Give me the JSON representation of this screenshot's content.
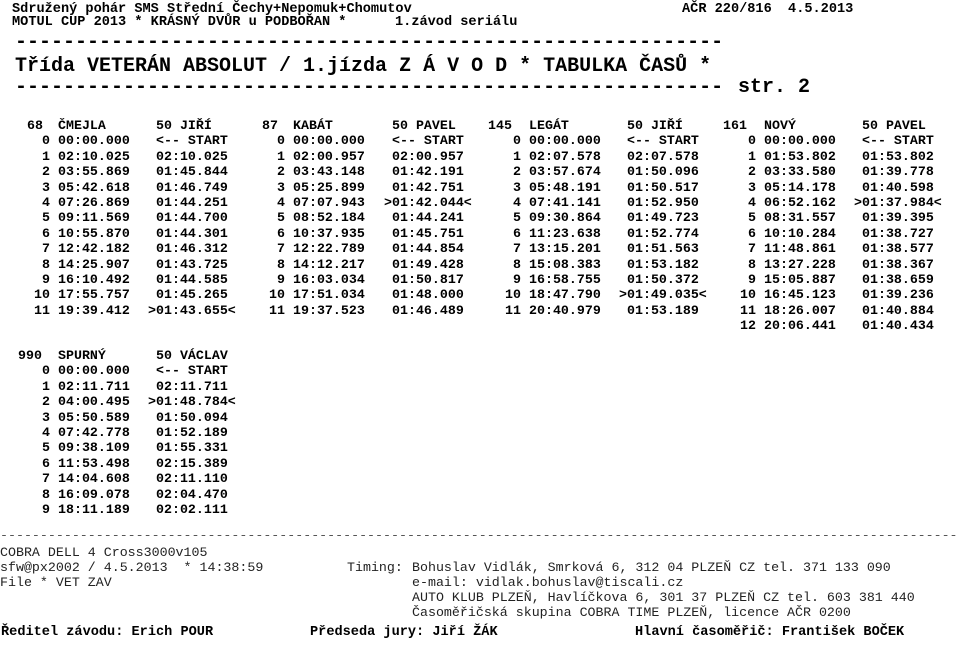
{
  "header": {
    "organizer": "Sdružený pohár SMS Střední Čechy+Nepomuk+Chomutov",
    "permit": "AČR 220/816  4.5.2013",
    "event": "MOTUL CUP 2013 * KRÁSNÝ DVŮR u PODBOŘAN *",
    "round": "1.závod seriálu",
    "title": "Třída VETERÁN ABSOLUT / 1.jízda Z Á V O D * TABULKA ČASŮ *",
    "page": "str. 2"
  },
  "blocks": [
    {
      "number": "68",
      "surname": "ČMEJLA",
      "driver": "50 JIŘÍ",
      "laps": [
        [
          "0",
          "00:00.000",
          "<-- START"
        ],
        [
          "1",
          "02:10.025",
          "02:10.025"
        ],
        [
          "2",
          "03:55.869",
          "01:45.844"
        ],
        [
          "3",
          "05:42.618",
          "01:46.749"
        ],
        [
          "4",
          "07:26.869",
          "01:44.251"
        ],
        [
          "5",
          "09:11.569",
          "01:44.700"
        ],
        [
          "6",
          "10:55.870",
          "01:44.301"
        ],
        [
          "7",
          "12:42.182",
          "01:46.312"
        ],
        [
          "8",
          "14:25.907",
          "01:43.725"
        ],
        [
          "9",
          "16:10.492",
          "01:44.585"
        ],
        [
          "10",
          "17:55.757",
          "01:45.265"
        ],
        [
          "11",
          "19:39.412",
          ">01:43.655<"
        ]
      ]
    },
    {
      "number": "87",
      "surname": "KABÁT",
      "driver": "50 PAVEL",
      "laps": [
        [
          "0",
          "00:00.000",
          "<-- START"
        ],
        [
          "1",
          "02:00.957",
          "02:00.957"
        ],
        [
          "2",
          "03:43.148",
          "01:42.191"
        ],
        [
          "3",
          "05:25.899",
          "01:42.751"
        ],
        [
          "4",
          "07:07.943",
          ">01:42.044<"
        ],
        [
          "5",
          "08:52.184",
          "01:44.241"
        ],
        [
          "6",
          "10:37.935",
          "01:45.751"
        ],
        [
          "7",
          "12:22.789",
          "01:44.854"
        ],
        [
          "8",
          "14:12.217",
          "01:49.428"
        ],
        [
          "9",
          "16:03.034",
          "01:50.817"
        ],
        [
          "10",
          "17:51.034",
          "01:48.000"
        ],
        [
          "11",
          "19:37.523",
          "01:46.489"
        ]
      ]
    },
    {
      "number": "145",
      "surname": "LEGÁT",
      "driver": "50 JIŘÍ",
      "laps": [
        [
          "0",
          "00:00.000",
          "<-- START"
        ],
        [
          "1",
          "02:07.578",
          "02:07.578"
        ],
        [
          "2",
          "03:57.674",
          "01:50.096"
        ],
        [
          "3",
          "05:48.191",
          "01:50.517"
        ],
        [
          "4",
          "07:41.141",
          "01:52.950"
        ],
        [
          "5",
          "09:30.864",
          "01:49.723"
        ],
        [
          "6",
          "11:23.638",
          "01:52.774"
        ],
        [
          "7",
          "13:15.201",
          "01:51.563"
        ],
        [
          "8",
          "15:08.383",
          "01:53.182"
        ],
        [
          "9",
          "16:58.755",
          "01:50.372"
        ],
        [
          "10",
          "18:47.790",
          ">01:49.035<"
        ],
        [
          "11",
          "20:40.979",
          "01:53.189"
        ]
      ]
    },
    {
      "number": "161",
      "surname": "NOVÝ",
      "driver": "50 PAVEL",
      "laps": [
        [
          "0",
          "00:00.000",
          "<-- START"
        ],
        [
          "1",
          "01:53.802",
          "01:53.802"
        ],
        [
          "2",
          "03:33.580",
          "01:39.778"
        ],
        [
          "3",
          "05:14.178",
          "01:40.598"
        ],
        [
          "4",
          "06:52.162",
          ">01:37.984<"
        ],
        [
          "5",
          "08:31.557",
          "01:39.395"
        ],
        [
          "6",
          "10:10.284",
          "01:38.727"
        ],
        [
          "7",
          "11:48.861",
          "01:38.577"
        ],
        [
          "8",
          "13:27.228",
          "01:38.367"
        ],
        [
          "9",
          "15:05.887",
          "01:38.659"
        ],
        [
          "10",
          "16:45.123",
          "01:39.236"
        ],
        [
          "11",
          "18:26.007",
          "01:40.884"
        ],
        [
          "12",
          "20:06.441",
          "01:40.434"
        ]
      ]
    },
    {
      "number": "990",
      "surname": "SPURNÝ",
      "driver": "50 VÁCLAV",
      "laps": [
        [
          "0",
          "00:00.000",
          "<-- START"
        ],
        [
          "1",
          "02:11.711",
          "02:11.711"
        ],
        [
          "2",
          "04:00.495",
          ">01:48.784<"
        ],
        [
          "3",
          "05:50.589",
          "01:50.094"
        ],
        [
          "4",
          "07:42.778",
          "01:52.189"
        ],
        [
          "5",
          "09:38.109",
          "01:55.331"
        ],
        [
          "6",
          "11:53.498",
          "02:15.389"
        ],
        [
          "7",
          "14:04.608",
          "02:11.110"
        ],
        [
          "8",
          "16:09.078",
          "02:04.470"
        ],
        [
          "9",
          "18:11.189",
          "02:02.111"
        ]
      ]
    }
  ],
  "footer": {
    "system": "COBRA DELL 4 Cross3000v105",
    "software": "sfw@px2002 / 4.5.2013  * 14:38:59",
    "file": "File * VET ZAV",
    "timing_label": "Timing:",
    "timing_lines": [
      "Bohuslav Vidlák, Smrková 6, 312 04 PLZEŇ CZ tel. 371 133 090",
      "e-mail: vidlak.bohuslav@tiscali.cz",
      "AUTO KLUB PLZEŇ, Havlíčkova 6, 301 37 PLZEŇ CZ tel. 603 381 440",
      "Časoměřičská skupina COBRA TIME PLZEŇ, licence AČR 0200"
    ],
    "race_director": "Ředitel závodu: Erich POUR",
    "jury_chair": "Předseda jury: Jiří ŽÁK",
    "chief_timekeeper": "Hlavní časoměřič: František BOČEK"
  }
}
